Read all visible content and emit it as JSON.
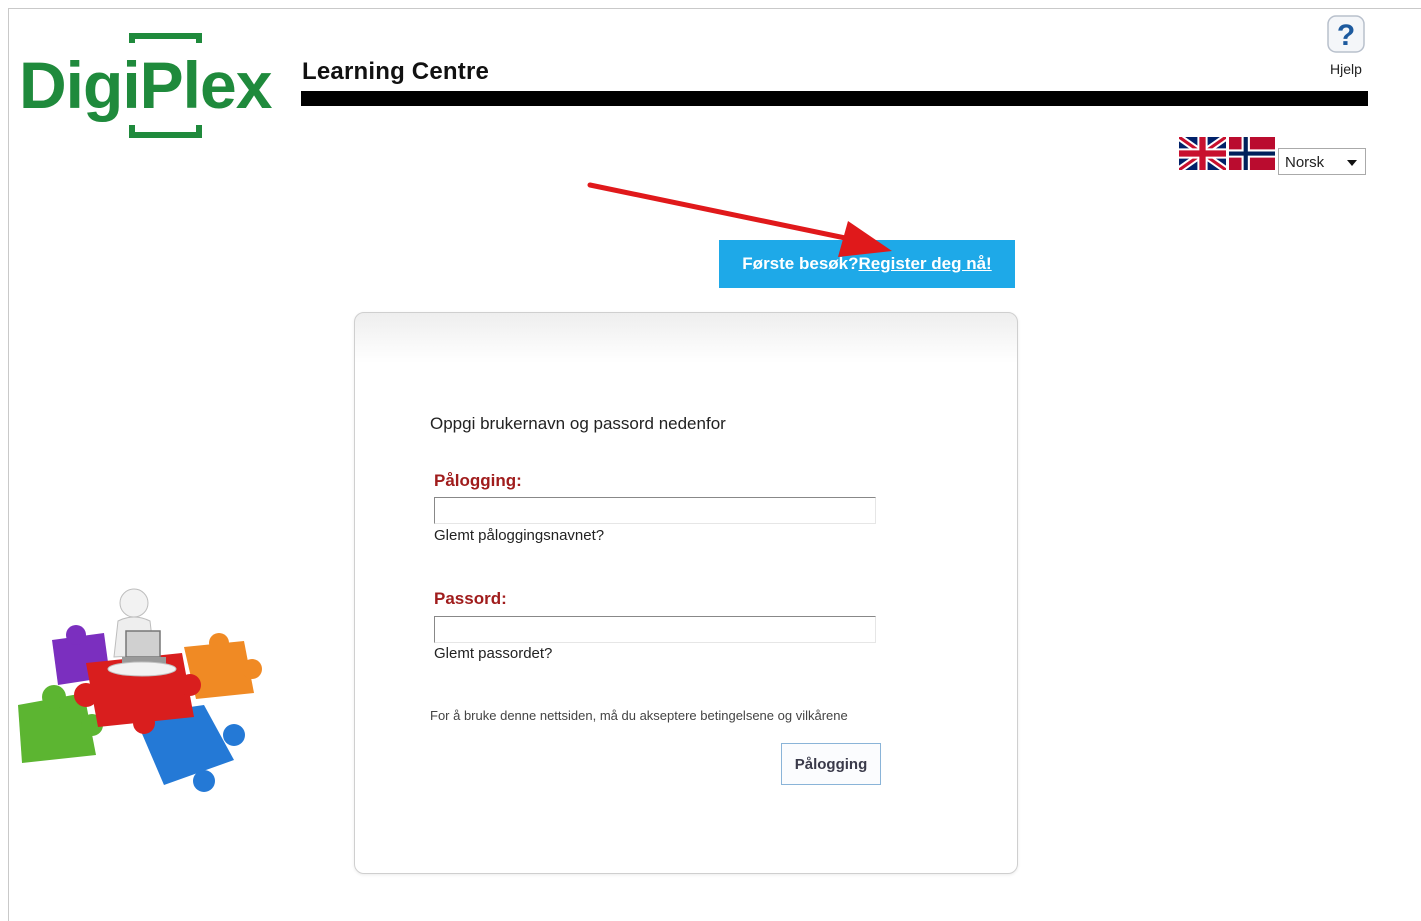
{
  "header": {
    "logo_text": "DigiPlex",
    "site_title": "Learning Centre",
    "help_label": "Hjelp"
  },
  "language": {
    "flags": [
      "uk-flag-icon",
      "norway-flag-icon"
    ],
    "selected": "Norsk"
  },
  "register": {
    "prompt": "Første besøk?",
    "link": " Register deg nå!"
  },
  "login": {
    "instructions": "Oppgi brukernavn og passord nedenfor",
    "username_label": "Pålogging:",
    "username_value": "",
    "forgot_username": "Glemt påloggingsnavnet?",
    "password_label": "Passord:",
    "password_value": "",
    "forgot_password": "Glemt passordet?",
    "terms": "For å bruke denne nettsiden, må du akseptere betingelsene og vilkårene",
    "button_label": "Pålogging"
  },
  "colors": {
    "brand_green": "#1f8a3c",
    "banner_blue": "#1ea9e8",
    "label_red": "#a01c1c",
    "annotation_arrow": "#e0191b"
  }
}
